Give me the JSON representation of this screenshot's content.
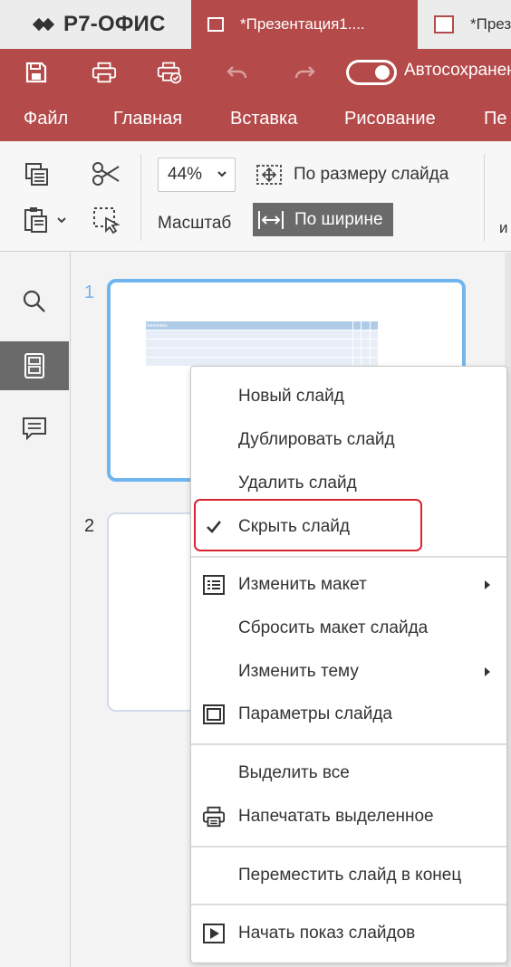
{
  "app": {
    "logo_text": "Р7-ОФИС",
    "tabs": [
      {
        "label": "*Презентация1...."
      },
      {
        "label": "*Презен"
      }
    ]
  },
  "quickbar": {
    "autosave_label": "Автосохранение"
  },
  "menu": {
    "items": [
      "Файл",
      "Главная",
      "Вставка",
      "Рисование",
      "Пе"
    ]
  },
  "ribbon": {
    "zoom_value": "44%",
    "zoom_label": "Масштаб",
    "fit_slide_label": "По размеру слайда",
    "fit_width_label": "По ширине",
    "partial_label": "и"
  },
  "thumbnails": {
    "slides": [
      {
        "number": "1",
        "table_header": "Заголовок"
      },
      {
        "number": "2"
      }
    ]
  },
  "context_menu": {
    "items": [
      {
        "label": "Новый слайд"
      },
      {
        "label": "Дублировать слайд"
      },
      {
        "label": "Удалить слайд"
      },
      {
        "label": "Скрыть слайд",
        "checked": true
      },
      {
        "label": "Изменить макет",
        "icon": "layout-icon",
        "submenu": true
      },
      {
        "label": "Сбросить макет слайда"
      },
      {
        "label": "Изменить тему",
        "submenu": true
      },
      {
        "label": "Параметры слайда",
        "icon": "slide-settings-icon"
      },
      {
        "label": "Выделить все"
      },
      {
        "label": "Напечатать выделенное",
        "icon": "print-icon"
      },
      {
        "label": "Переместить слайд в конец"
      },
      {
        "label": "Начать показ слайдов",
        "icon": "play-icon"
      }
    ]
  },
  "colors": {
    "brand": "#b54a4a",
    "selected_thumb_border": "#70b5f0",
    "highlight_annotation": "#d9232e",
    "active_side_button": "#6a6a6a"
  }
}
